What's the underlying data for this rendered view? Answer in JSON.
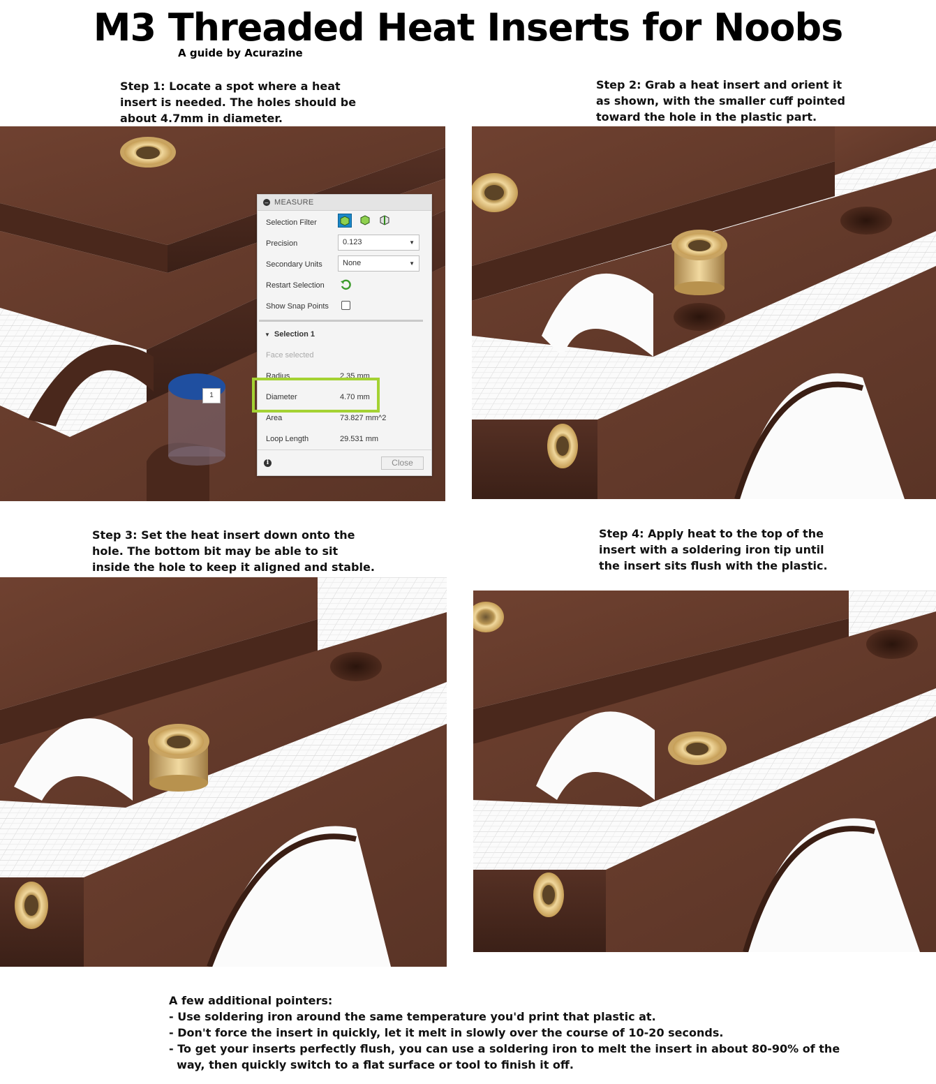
{
  "title": "M3 Threaded Heat Inserts for Noobs",
  "subtitle": "A guide by Acurazine",
  "steps": {
    "step1": "Step 1: Locate a spot where a heat\ninsert is needed. The holes should be\nabout 4.7mm in diameter.",
    "step2": "Step 2: Grab a heat insert and orient it\nas shown, with the smaller cuff pointed\ntoward the hole in the plastic part.",
    "step3": "Step 3: Set the heat insert down onto the\nhole. The bottom bit may be able to sit\ninside the hole to keep it aligned and stable.",
    "step4": "Step 4: Apply heat to the top of the\ninsert with a soldering iron tip until\nthe insert sits flush with the plastic."
  },
  "measure_panel": {
    "header": "MEASURE",
    "selection_filter_label": "Selection Filter",
    "precision_label": "Precision",
    "precision_value": "0.123",
    "secondary_units_label": "Secondary Units",
    "secondary_units_value": "None",
    "restart_selection_label": "Restart Selection",
    "show_snap_points_label": "Show Snap Points",
    "selection_section": "Selection 1",
    "face_selected": "Face selected",
    "radius_label": "Radius",
    "radius_value": "2.35 mm",
    "diameter_label": "Diameter",
    "diameter_value": "4.70 mm",
    "area_label": "Area",
    "area_value": "73.827 mm^2",
    "loop_length_label": "Loop Length",
    "loop_length_value": "29.531 mm",
    "close_label": "Close",
    "selection_badge": "1"
  },
  "pointers": {
    "heading": "A few additional pointers:",
    "items": [
      "- Use soldering iron around the same temperature you'd print that plastic at.",
      "- Don't force the insert in quickly, let it melt in slowly over the course of 10-20 seconds.",
      "- To get your inserts perfectly flush, you can use a soldering iron to melt the insert in about 80-90% of the",
      "  way, then quickly switch to a flat surface or tool to finish it off."
    ]
  },
  "colors": {
    "plastic": "#5e3627",
    "plastic_dark": "#3e2218",
    "brass": "#d8b878",
    "highlight": "#a4d233",
    "selected_face": "#1f4fa0"
  }
}
